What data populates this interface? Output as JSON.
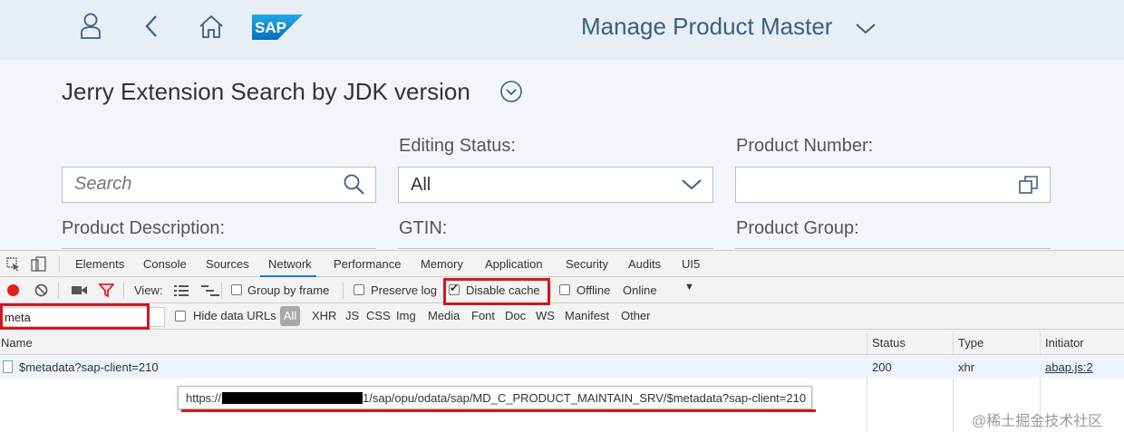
{
  "shell": {
    "title": "Manage Product Master",
    "logo_text": "SAP",
    "icons": [
      "user-icon",
      "back-icon",
      "home-icon",
      "chevron-down-icon"
    ]
  },
  "filter": {
    "variant_title": "Jerry Extension Search by JDK version",
    "search_placeholder": "Search",
    "editing_status_label": "Editing Status:",
    "editing_status_value": "All",
    "product_number_label": "Product Number:",
    "product_description_label": "Product Description:",
    "gtin_label": "GTIN:",
    "product_group_label": "Product Group:"
  },
  "devtools": {
    "tabs": [
      "Elements",
      "Console",
      "Sources",
      "Network",
      "Performance",
      "Memory",
      "Application",
      "Security",
      "Audits",
      "UI5"
    ],
    "active_tab": "Network",
    "toolbar": {
      "view_label": "View:",
      "group_by_frame": "Group by frame",
      "preserve_log": "Preserve log",
      "disable_cache": "Disable cache",
      "offline": "Offline",
      "throttle": "Online"
    },
    "filter": {
      "value": "meta",
      "hide_data_urls": "Hide data URLs",
      "types": [
        "All",
        "XHR",
        "JS",
        "CSS",
        "Img",
        "Media",
        "Font",
        "Doc",
        "WS",
        "Manifest",
        "Other"
      ]
    },
    "columns": [
      "Name",
      "Status",
      "Type",
      "Initiator"
    ],
    "rows": [
      {
        "name": "$metadata?sap-client=210",
        "status": "200",
        "type": "xhr",
        "initiator": "abap.js:2"
      }
    ],
    "tooltip": {
      "prefix": "https://",
      "suffix": "1/sap/opu/odata/sap/MD_C_PRODUCT_MAINTAIN_SRV/$metadata?sap-client=210"
    }
  },
  "watermark": "@稀土掘金技术社区",
  "colors": {
    "shell_bg": "#e7eef4",
    "filter_bg": "#f2f6fa",
    "title_blue": "#3c5f7e",
    "highlight_red": "#d0161d",
    "record_red": "#e0201f"
  }
}
